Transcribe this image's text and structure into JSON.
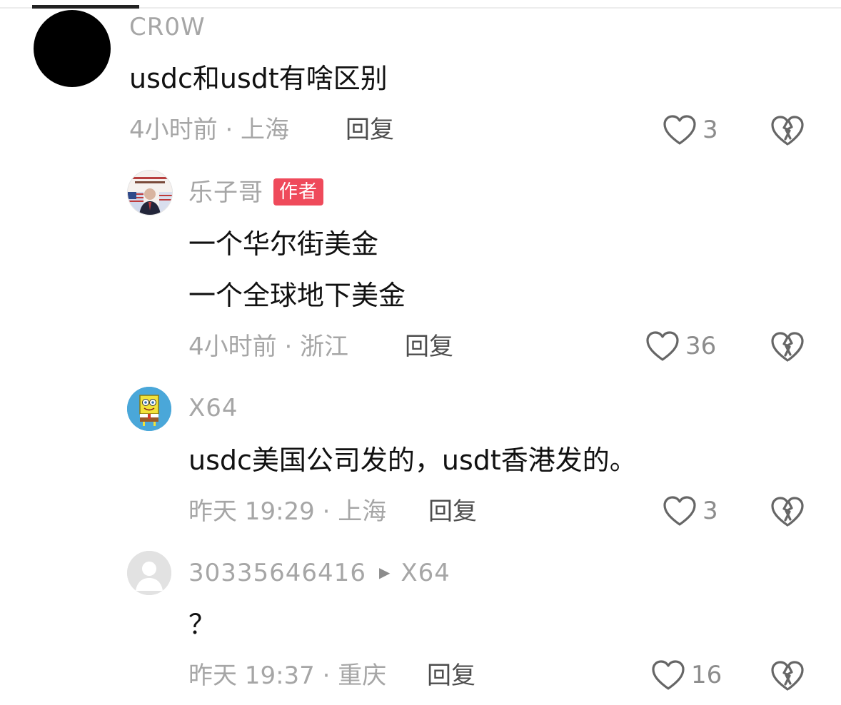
{
  "comments": [
    {
      "username": "CR0W",
      "lines": [
        "usdc和usdt有啥区别"
      ],
      "time_location": "4小时前 · 上海",
      "reply_label": "回复",
      "likes": "3"
    },
    {
      "username": "乐子哥",
      "badge": "作者",
      "lines": [
        "一个华尔街美金",
        "一个全球地下美金"
      ],
      "time_location": "4小时前 · 浙江",
      "reply_label": "回复",
      "likes": "36"
    },
    {
      "username": "X64",
      "lines": [
        "usdc美国公司发的，usdt香港发的。"
      ],
      "time_location": "昨天 19:29 · 上海",
      "reply_label": "回复",
      "likes": "3"
    },
    {
      "username": "30335646416",
      "reply_to": "X64",
      "lines": [
        "？"
      ],
      "time_location": "昨天 19:37 · 重庆",
      "reply_label": "回复",
      "likes": "16"
    }
  ],
  "icons": {
    "like": "heart-outline-icon",
    "dislike": "broken-heart-icon",
    "reply_arrow": "triangle-right-icon"
  },
  "colors": {
    "badge": "#ef4a5b",
    "meta_text": "#a6a6a6",
    "body_text": "#111111"
  }
}
